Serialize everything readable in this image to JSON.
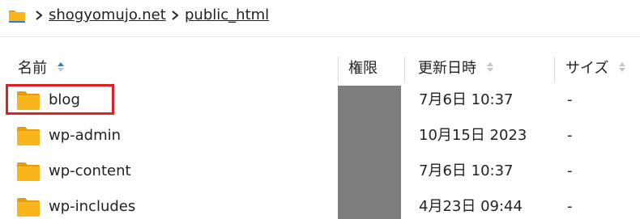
{
  "breadcrumb": {
    "items": [
      {
        "label": "shogyomujo.net"
      },
      {
        "label": "public_html"
      }
    ]
  },
  "table": {
    "columns": {
      "name": "名前",
      "permission": "権限",
      "modified": "更新日時",
      "size": "サイズ"
    },
    "rows": [
      {
        "name": "blog",
        "modified": "7月6日 10:37",
        "size": "-"
      },
      {
        "name": "wp-admin",
        "modified": "10月15日 2023",
        "size": "-"
      },
      {
        "name": "wp-content",
        "modified": "7月6日 10:37",
        "size": "-"
      },
      {
        "name": "wp-includes",
        "modified": "4月23日 09:44",
        "size": "-"
      }
    ]
  },
  "colors": {
    "folder": "#F9B51C",
    "folder_dark": "#E89C0C",
    "sort_active": "#2F7BD8",
    "highlight": "#E02020",
    "permission_mask": "#7D7D7D"
  },
  "icons": {
    "root": "folder-icon",
    "separator": "chevron-right-icon",
    "sort": "sort-icon"
  }
}
